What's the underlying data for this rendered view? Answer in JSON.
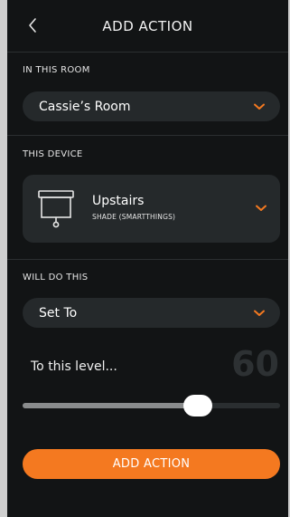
{
  "header": {
    "title": "ADD ACTION",
    "back_icon": "chevron-left-icon"
  },
  "room_section": {
    "label": "IN THIS ROOM",
    "selected": "Cassie’s Room"
  },
  "device_section": {
    "label": "THIS DEVICE",
    "device_name": "Upstairs",
    "device_type": "SHADE (SMARTTHINGS)",
    "icon": "window-shade-icon"
  },
  "action_section": {
    "label": "WILL DO THIS",
    "selected": "Set To"
  },
  "level": {
    "label": "To this level...",
    "value": "60",
    "slider_fraction": 0.68
  },
  "submit": {
    "label": "ADD ACTION"
  },
  "colors": {
    "accent": "#f47920",
    "background": "#121415",
    "panel": "#25292b"
  }
}
